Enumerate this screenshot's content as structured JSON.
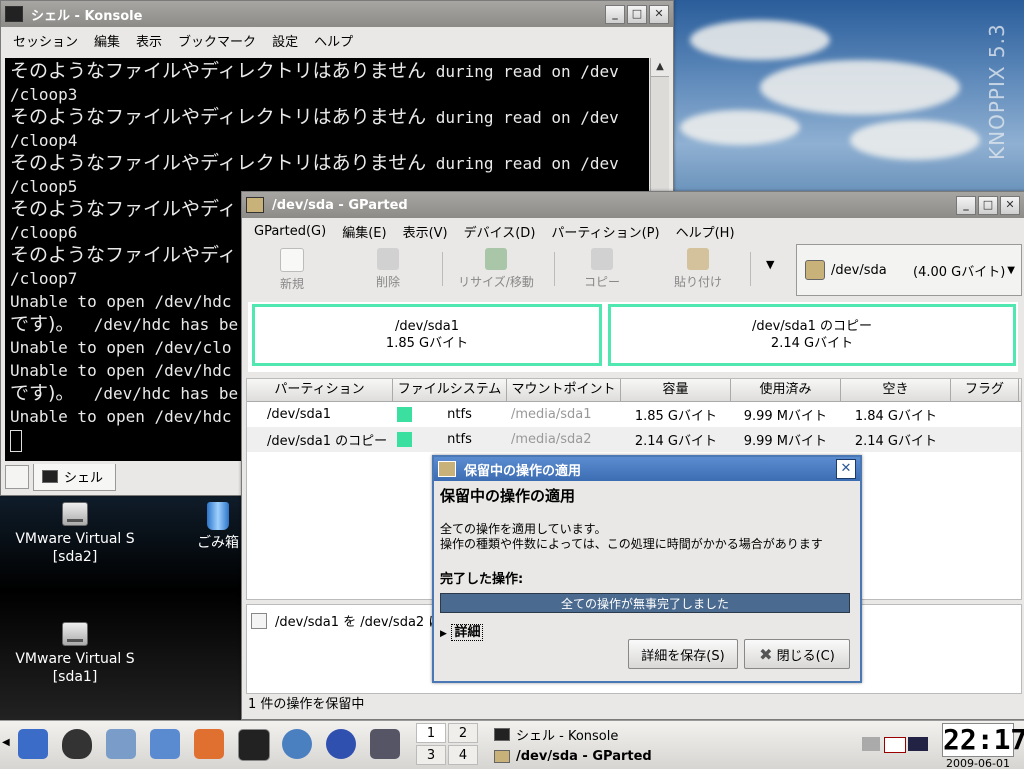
{
  "desktop": {
    "watermark": "KNOPPIX 5.3",
    "icons": [
      {
        "label": "VMware Virtual S",
        "sublabel": "[sda2]"
      },
      {
        "label": "ごみ箱",
        "sublabel": ""
      },
      {
        "label": "VMware Virtual S",
        "sublabel": "[sda1]"
      }
    ]
  },
  "konsole": {
    "title": "シェル - Konsole",
    "menu": [
      "セッション",
      "編集",
      "表示",
      "ブックマーク",
      "設定",
      "ヘルプ"
    ],
    "lines": [
      {
        "jp": "そのようなファイルやディレクトリはありません",
        "en": " during read on /dev"
      },
      {
        "jp": "",
        "en": "/cloop3"
      },
      {
        "jp": "そのようなファイルやディレクトリはありません",
        "en": " during read on /dev"
      },
      {
        "jp": "",
        "en": "/cloop4"
      },
      {
        "jp": "そのようなファイルやディレクトリはありません",
        "en": " during read on /dev"
      },
      {
        "jp": "",
        "en": "/cloop5"
      },
      {
        "jp": "そのようなファイルやディ",
        "en": ""
      },
      {
        "jp": "",
        "en": "/cloop6"
      },
      {
        "jp": "そのようなファイルやディ",
        "en": ""
      },
      {
        "jp": "",
        "en": "/cloop7"
      },
      {
        "jp": "",
        "en": "Unable to open /dev/hdc"
      },
      {
        "jp": "です)。",
        "en": "  /dev/hdc has be"
      },
      {
        "jp": "",
        "en": "Unable to open /dev/clo"
      },
      {
        "jp": "",
        "en": "Unable to open /dev/hdc"
      },
      {
        "jp": "です)。",
        "en": "  /dev/hdc has be"
      },
      {
        "jp": "",
        "en": "Unable to open /dev/hdc"
      }
    ],
    "tab_label": "シェル"
  },
  "gparted": {
    "title": "/dev/sda - GParted",
    "menu": [
      "GParted(G)",
      "編集(E)",
      "表示(V)",
      "デバイス(D)",
      "パーティション(P)",
      "ヘルプ(H)"
    ],
    "toolbar": {
      "new": "新規",
      "delete": "削除",
      "resize": "リサイズ/移動",
      "copy": "コピー",
      "paste": "貼り付け"
    },
    "device": {
      "name": "/dev/sda",
      "size": "(4.00 Gバイト)"
    },
    "diskmap": [
      {
        "name": "/dev/sda1",
        "size": "1.85 Gバイト"
      },
      {
        "name": "/dev/sda1 のコピー",
        "size": "2.14 Gバイト"
      }
    ],
    "columns": [
      "パーティション",
      "ファイルシステム",
      "マウントポイント",
      "容量",
      "使用済み",
      "空き",
      "フラグ"
    ],
    "rows": [
      {
        "partition": "/dev/sda1",
        "fs": "ntfs",
        "mount": "/media/sda1",
        "size": "1.85 Gバイト",
        "used": "9.99 Mバイト",
        "free": "1.84 Gバイト",
        "flags": ""
      },
      {
        "partition": "/dev/sda1 のコピー",
        "fs": "ntfs",
        "mount": "/media/sda2",
        "size": "2.14 Gバイト",
        "used": "9.99 Mバイト",
        "free": "2.14 Gバイト",
        "flags": ""
      }
    ],
    "pending_op": "/dev/sda1 を /dev/sda2 に",
    "status": "1 件の操作を保留中"
  },
  "dialog": {
    "title": "保留中の操作の適用",
    "heading": "保留中の操作の適用",
    "line1": "全ての操作を適用しています。",
    "line2": "操作の種類や件数によっては、この処理に時間がかかる場合があります",
    "completed_label": "完了した操作:",
    "progress_text": "全ての操作が無事完了しました",
    "progress_fraction": 1.0,
    "details_label": "詳細",
    "save_button": "詳細を保存(S)",
    "close_button": "閉じる(C)"
  },
  "taskbar": {
    "pager": [
      "1",
      "2",
      "3",
      "4"
    ],
    "tasks": [
      {
        "label": "シェル - Konsole",
        "active": false
      },
      {
        "label": "/dev/sda - GParted",
        "active": true
      }
    ],
    "clock": "22:17",
    "date": "2009-06-01"
  }
}
